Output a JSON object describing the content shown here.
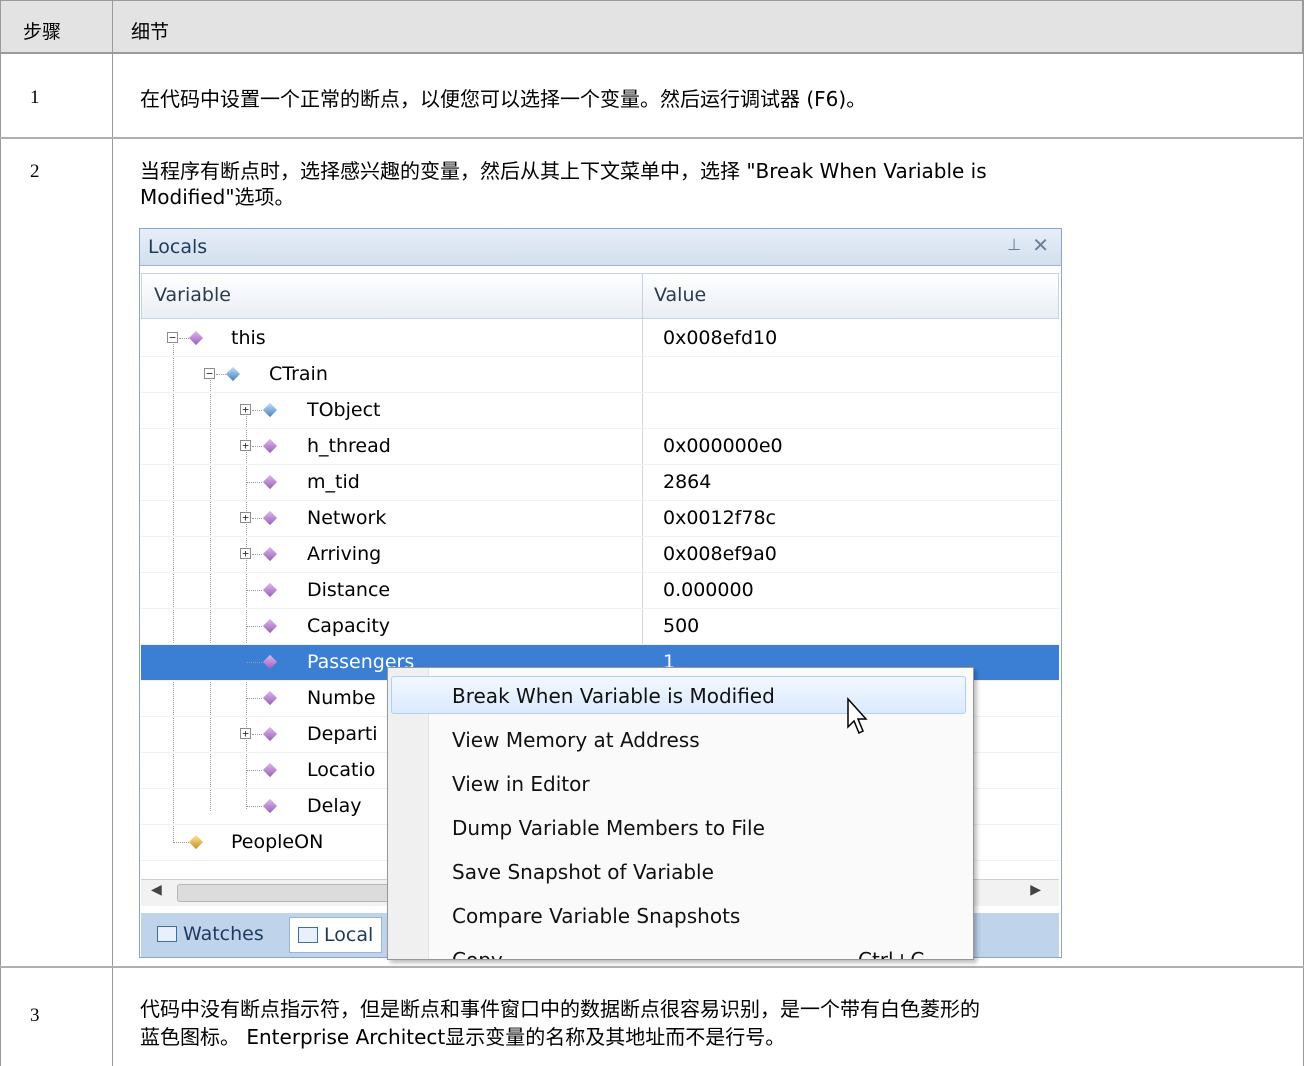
{
  "table": {
    "header": {
      "col1": "步骤",
      "col2": "细节"
    },
    "rows": [
      {
        "step": "1",
        "text": "在代码中设置一个正常的断点，以便您可以选择一个变量。然后运行调试器 (F6)。"
      },
      {
        "step": "2",
        "text_line1": "当程序有断点时，选择感兴趣的变量，然后从其上下文菜单中，选择 \"Break When Variable is",
        "text_line2": "Modified\"选项。"
      },
      {
        "step": "3",
        "text_line1": "代码中没有断点指示符，但是断点和事件窗口中的数据断点很容易识别，是一个带有白色菱形的",
        "text_line2": "蓝色图标。 Enterprise Architect显示变量的名称及其地址而不是行号。"
      }
    ]
  },
  "locals": {
    "title": "Locals",
    "pin_icon": "pin-icon",
    "close_icon": "close-icon",
    "columns": {
      "variable": "Variable",
      "value": "Value"
    },
    "rows": [
      {
        "name": "this",
        "value": "0x008efd10"
      },
      {
        "name": "CTrain",
        "value": ""
      },
      {
        "name": "TObject",
        "value": ""
      },
      {
        "name": "h_thread",
        "value": "0x000000e0"
      },
      {
        "name": "m_tid",
        "value": "2864"
      },
      {
        "name": "Network",
        "value": "0x0012f78c"
      },
      {
        "name": "Arriving",
        "value": "0x008ef9a0"
      },
      {
        "name": "Distance",
        "value": "0.000000"
      },
      {
        "name": "Capacity",
        "value": "500"
      },
      {
        "name": "Passengers",
        "value": "1"
      },
      {
        "name": "Numbe",
        "value": ""
      },
      {
        "name": "Departi",
        "value": ""
      },
      {
        "name": "Locatio",
        "value": ""
      },
      {
        "name": "Delay",
        "value": ""
      },
      {
        "name": "PeopleON",
        "value": ""
      }
    ],
    "tabs": {
      "watches": "Watches",
      "locals": "Local"
    }
  },
  "context_menu": {
    "items": [
      {
        "label": "Break When Variable is Modified",
        "shortcut": ""
      },
      {
        "label": "View Memory at Address",
        "shortcut": ""
      },
      {
        "label": "View in Editor",
        "shortcut": ""
      },
      {
        "label": "Dump Variable Members to File",
        "shortcut": ""
      },
      {
        "label": "Save Snapshot of Variable",
        "shortcut": ""
      },
      {
        "label": "Compare Variable Snapshots",
        "shortcut": ""
      },
      {
        "label": "Copy",
        "shortcut": "Ctrl+C"
      }
    ]
  },
  "colors": {
    "selection": "#3b7fd4",
    "tab_strip": "#bfd3ea",
    "header_bg": "#e3e3e3"
  }
}
